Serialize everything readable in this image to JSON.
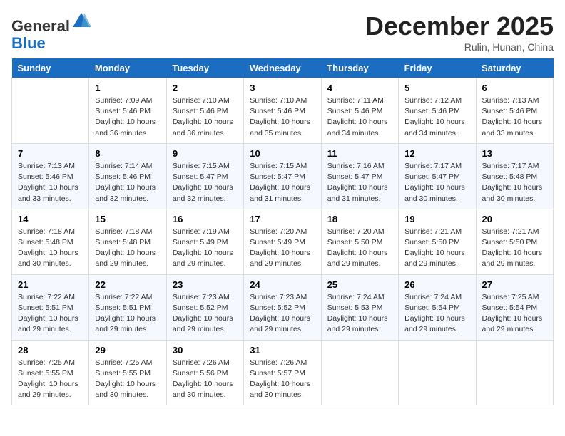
{
  "header": {
    "logo_general": "General",
    "logo_blue": "Blue",
    "month_title": "December 2025",
    "location": "Rulin, Hunan, China"
  },
  "weekdays": [
    "Sunday",
    "Monday",
    "Tuesday",
    "Wednesday",
    "Thursday",
    "Friday",
    "Saturday"
  ],
  "weeks": [
    [
      {
        "day": "",
        "info": ""
      },
      {
        "day": "1",
        "info": "Sunrise: 7:09 AM\nSunset: 5:46 PM\nDaylight: 10 hours\nand 36 minutes."
      },
      {
        "day": "2",
        "info": "Sunrise: 7:10 AM\nSunset: 5:46 PM\nDaylight: 10 hours\nand 36 minutes."
      },
      {
        "day": "3",
        "info": "Sunrise: 7:10 AM\nSunset: 5:46 PM\nDaylight: 10 hours\nand 35 minutes."
      },
      {
        "day": "4",
        "info": "Sunrise: 7:11 AM\nSunset: 5:46 PM\nDaylight: 10 hours\nand 34 minutes."
      },
      {
        "day": "5",
        "info": "Sunrise: 7:12 AM\nSunset: 5:46 PM\nDaylight: 10 hours\nand 34 minutes."
      },
      {
        "day": "6",
        "info": "Sunrise: 7:13 AM\nSunset: 5:46 PM\nDaylight: 10 hours\nand 33 minutes."
      }
    ],
    [
      {
        "day": "7",
        "info": "Sunrise: 7:13 AM\nSunset: 5:46 PM\nDaylight: 10 hours\nand 33 minutes."
      },
      {
        "day": "8",
        "info": "Sunrise: 7:14 AM\nSunset: 5:46 PM\nDaylight: 10 hours\nand 32 minutes."
      },
      {
        "day": "9",
        "info": "Sunrise: 7:15 AM\nSunset: 5:47 PM\nDaylight: 10 hours\nand 32 minutes."
      },
      {
        "day": "10",
        "info": "Sunrise: 7:15 AM\nSunset: 5:47 PM\nDaylight: 10 hours\nand 31 minutes."
      },
      {
        "day": "11",
        "info": "Sunrise: 7:16 AM\nSunset: 5:47 PM\nDaylight: 10 hours\nand 31 minutes."
      },
      {
        "day": "12",
        "info": "Sunrise: 7:17 AM\nSunset: 5:47 PM\nDaylight: 10 hours\nand 30 minutes."
      },
      {
        "day": "13",
        "info": "Sunrise: 7:17 AM\nSunset: 5:48 PM\nDaylight: 10 hours\nand 30 minutes."
      }
    ],
    [
      {
        "day": "14",
        "info": "Sunrise: 7:18 AM\nSunset: 5:48 PM\nDaylight: 10 hours\nand 30 minutes."
      },
      {
        "day": "15",
        "info": "Sunrise: 7:18 AM\nSunset: 5:48 PM\nDaylight: 10 hours\nand 29 minutes."
      },
      {
        "day": "16",
        "info": "Sunrise: 7:19 AM\nSunset: 5:49 PM\nDaylight: 10 hours\nand 29 minutes."
      },
      {
        "day": "17",
        "info": "Sunrise: 7:20 AM\nSunset: 5:49 PM\nDaylight: 10 hours\nand 29 minutes."
      },
      {
        "day": "18",
        "info": "Sunrise: 7:20 AM\nSunset: 5:50 PM\nDaylight: 10 hours\nand 29 minutes."
      },
      {
        "day": "19",
        "info": "Sunrise: 7:21 AM\nSunset: 5:50 PM\nDaylight: 10 hours\nand 29 minutes."
      },
      {
        "day": "20",
        "info": "Sunrise: 7:21 AM\nSunset: 5:50 PM\nDaylight: 10 hours\nand 29 minutes."
      }
    ],
    [
      {
        "day": "21",
        "info": "Sunrise: 7:22 AM\nSunset: 5:51 PM\nDaylight: 10 hours\nand 29 minutes."
      },
      {
        "day": "22",
        "info": "Sunrise: 7:22 AM\nSunset: 5:51 PM\nDaylight: 10 hours\nand 29 minutes."
      },
      {
        "day": "23",
        "info": "Sunrise: 7:23 AM\nSunset: 5:52 PM\nDaylight: 10 hours\nand 29 minutes."
      },
      {
        "day": "24",
        "info": "Sunrise: 7:23 AM\nSunset: 5:52 PM\nDaylight: 10 hours\nand 29 minutes."
      },
      {
        "day": "25",
        "info": "Sunrise: 7:24 AM\nSunset: 5:53 PM\nDaylight: 10 hours\nand 29 minutes."
      },
      {
        "day": "26",
        "info": "Sunrise: 7:24 AM\nSunset: 5:54 PM\nDaylight: 10 hours\nand 29 minutes."
      },
      {
        "day": "27",
        "info": "Sunrise: 7:25 AM\nSunset: 5:54 PM\nDaylight: 10 hours\nand 29 minutes."
      }
    ],
    [
      {
        "day": "28",
        "info": "Sunrise: 7:25 AM\nSunset: 5:55 PM\nDaylight: 10 hours\nand 29 minutes."
      },
      {
        "day": "29",
        "info": "Sunrise: 7:25 AM\nSunset: 5:55 PM\nDaylight: 10 hours\nand 30 minutes."
      },
      {
        "day": "30",
        "info": "Sunrise: 7:26 AM\nSunset: 5:56 PM\nDaylight: 10 hours\nand 30 minutes."
      },
      {
        "day": "31",
        "info": "Sunrise: 7:26 AM\nSunset: 5:57 PM\nDaylight: 10 hours\nand 30 minutes."
      },
      {
        "day": "",
        "info": ""
      },
      {
        "day": "",
        "info": ""
      },
      {
        "day": "",
        "info": ""
      }
    ]
  ]
}
